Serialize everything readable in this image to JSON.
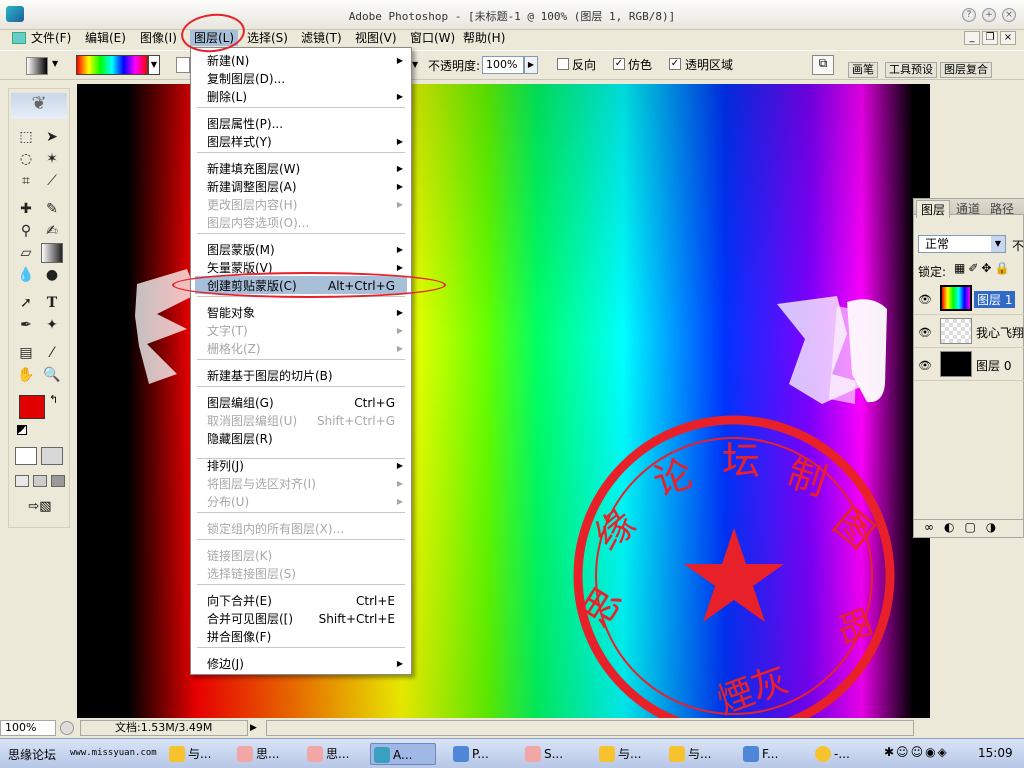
{
  "window": {
    "title": "Adobe Photoshop - [未标题-1 @ 100% (图层 1, RGB/8)]",
    "controls": [
      "?",
      "+",
      "×"
    ]
  },
  "menubar": {
    "items": [
      "文件(F)",
      "编辑(E)",
      "图像(I)",
      "图层(L)",
      "选择(S)",
      "滤镜(T)",
      "视图(V)",
      "窗口(W)",
      "帮助(H)"
    ],
    "doc_controls": [
      "_",
      "❐",
      "×"
    ]
  },
  "options": {
    "opacity_label": "不透明度:",
    "opacity_value": "100%",
    "reverse_label": "反向",
    "dither_label": "仿色",
    "transparency_label": "透明区域",
    "palette_tabs": [
      "画笔",
      "工具预设",
      "图层复合"
    ]
  },
  "layer_menu": {
    "items": [
      {
        "label": "新建(N)",
        "submenu": true
      },
      {
        "label": "复制图层(D)..."
      },
      {
        "label": "删除(L)",
        "submenu": true
      },
      {
        "label": "图层属性(P)..."
      },
      {
        "label": "图层样式(Y)",
        "submenu": true
      },
      {
        "label": "新建填充图层(W)",
        "submenu": true
      },
      {
        "label": "新建调整图层(A)",
        "submenu": true
      },
      {
        "label": "更改图层内容(H)",
        "disabled": true,
        "submenu": true
      },
      {
        "label": "图层内容选项(O)...",
        "disabled": true
      },
      {
        "label": "图层蒙版(M)",
        "submenu": true
      },
      {
        "label": "矢量蒙版(V)",
        "submenu": true
      },
      {
        "label": "创建剪贴蒙版(C)",
        "shortcut": "Alt+Ctrl+G"
      },
      {
        "label": "智能对象",
        "submenu": true
      },
      {
        "label": "文字(T)",
        "disabled": true,
        "submenu": true
      },
      {
        "label": "栅格化(Z)",
        "disabled": true,
        "submenu": true
      },
      {
        "label": "新建基于图层的切片(B)"
      },
      {
        "label": "图层编组(G)",
        "shortcut": "Ctrl+G"
      },
      {
        "label": "取消图层编组(U)",
        "shortcut": "Shift+Ctrl+G",
        "disabled": true
      },
      {
        "label": "隐藏图层(R)"
      },
      {
        "label": "排列(J)",
        "submenu": true
      },
      {
        "label": "将图层与选区对齐(I)",
        "disabled": true,
        "submenu": true
      },
      {
        "label": "分布(U)",
        "disabled": true,
        "submenu": true
      },
      {
        "label": "锁定组内的所有图层(X)...",
        "disabled": true
      },
      {
        "label": "链接图层(K)",
        "disabled": true
      },
      {
        "label": "选择链接图层(S)",
        "disabled": true
      },
      {
        "label": "向下合并(E)",
        "shortcut": "Ctrl+E"
      },
      {
        "label": "合并可见图层([)",
        "shortcut": "Shift+Ctrl+E"
      },
      {
        "label": "拼合图像(F)"
      },
      {
        "label": "修边(J)",
        "submenu": true
      }
    ],
    "highlighted_index": 11
  },
  "layers_panel": {
    "tabs": [
      "图层",
      "通道",
      "路径"
    ],
    "blend_mode": "正常",
    "opacity_short": "不",
    "lock_label": "锁定:",
    "layers": [
      {
        "name": "图层 1",
        "selected": true
      },
      {
        "name": "我心飞翔",
        "selected": false
      },
      {
        "name": "图层 0",
        "selected": false
      }
    ]
  },
  "stamp": {
    "text": "思缘论坛制图",
    "signature": "煙灰",
    "color": "#e8202a"
  },
  "status": {
    "zoom": "100%",
    "doc_info": "文档:1.53M/3.49M"
  },
  "taskbar": {
    "items": [
      "思缘论坛",
      "www.missyuan.com",
      "与...",
      "思...",
      "思...",
      "A...",
      "P...",
      "S...",
      "与...",
      "与...",
      "F...",
      "-..."
    ],
    "time": "15:09"
  },
  "colors": {
    "accent_red": "#e8202a",
    "menu_highlight": "#a8bfd9",
    "foreground_swatch": "#e00000",
    "background_swatch": "#000000"
  }
}
